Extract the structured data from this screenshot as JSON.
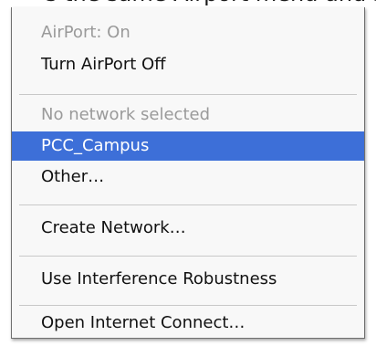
{
  "caption": "s the same Airport menu and selec",
  "colors": {
    "selection": "#3d6fd8",
    "disabled_text": "#9a9a9a",
    "text": "#111111"
  },
  "menu": {
    "status": "AirPort: On",
    "turn_off": "Turn AirPort Off",
    "no_network": "No network selected",
    "networks": [
      "PCC_Campus"
    ],
    "other": "Other…",
    "create_network": "Create Network…",
    "interference": "Use Interference Robustness",
    "open_connect": "Open Internet Connect…"
  }
}
